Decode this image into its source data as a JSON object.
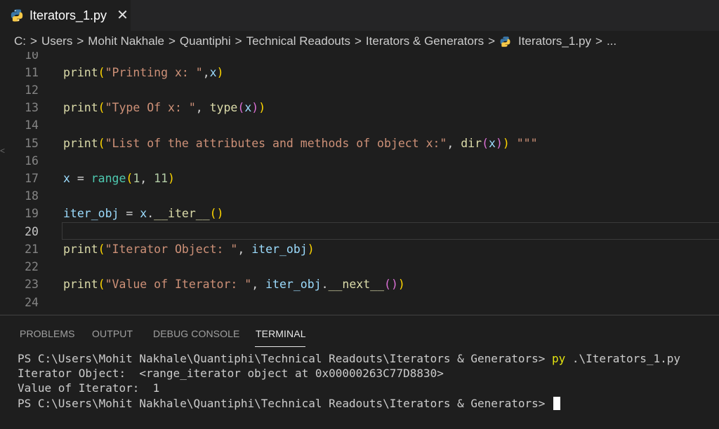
{
  "tab": {
    "filename": "Iterators_1.py",
    "close_glyph": "✕"
  },
  "breadcrumb": [
    "C:",
    "Users",
    "Mohit Nakhale",
    "Quantiphi",
    "Technical Readouts",
    "Iterators & Generators",
    "Iterators_1.py",
    "..."
  ],
  "editor": {
    "line_numbers": [
      "10",
      "11",
      "12",
      "13",
      "14",
      "15",
      "16",
      "17",
      "18",
      "19",
      "20",
      "21",
      "22",
      "23",
      "24"
    ],
    "active_line": "20",
    "lines": {
      "l11": [
        "print",
        "(",
        "\"Printing x: \"",
        ",",
        "x",
        ")"
      ],
      "l13": [
        "print",
        "(",
        "\"Type Of x: \"",
        ", ",
        "type",
        "(",
        "x",
        ")",
        ")"
      ],
      "l15": [
        "print",
        "(",
        "\"List of the attributes and methods of object x:\"",
        ", ",
        "dir",
        "(",
        "x",
        ")",
        ")",
        " \"\"\""
      ],
      "l17": [
        "x",
        " = ",
        "range",
        "(",
        "1",
        ", ",
        "11",
        ")"
      ],
      "l19": [
        "iter_obj",
        " = ",
        "x",
        ".",
        "__iter__",
        "()"
      ],
      "l21": [
        "print",
        "(",
        "\"Iterator Object: \"",
        ", ",
        "iter_obj",
        ")"
      ],
      "l23": [
        "print",
        "(",
        "\"Value of Iterator: \"",
        ", ",
        "iter_obj",
        ".",
        "__next__",
        "()",
        ")"
      ]
    }
  },
  "panel": {
    "tabs": [
      "PROBLEMS",
      "OUTPUT",
      "DEBUG CONSOLE",
      "TERMINAL"
    ],
    "active_tab": "TERMINAL"
  },
  "terminal": {
    "prompt1": "PS C:\\Users\\Mohit Nakhale\\Quantiphi\\Technical Readouts\\Iterators & Generators> ",
    "cmd": "py",
    "cmd_arg": " .\\Iterators_1.py",
    "out1": "Iterator Object:  <range_iterator object at 0x00000263C77D8830>",
    "out2": "Value of Iterator:  1",
    "prompt2": "PS C:\\Users\\Mohit Nakhale\\Quantiphi\\Technical Readouts\\Iterators & Generators> "
  },
  "colors": {
    "keyword_fn": "#dcdcaa",
    "string": "#ce9178",
    "variable": "#9cdcfe",
    "number": "#b5cea8",
    "bracket1": "#ffd700",
    "bracket2": "#da70d6",
    "builtin_class": "#4ec9b0",
    "python_icon_blue": "#3b77a8",
    "python_icon_yellow": "#f7c948"
  },
  "icons": {
    "tab": "python-icon",
    "breadcrumb_file": "python-icon"
  }
}
